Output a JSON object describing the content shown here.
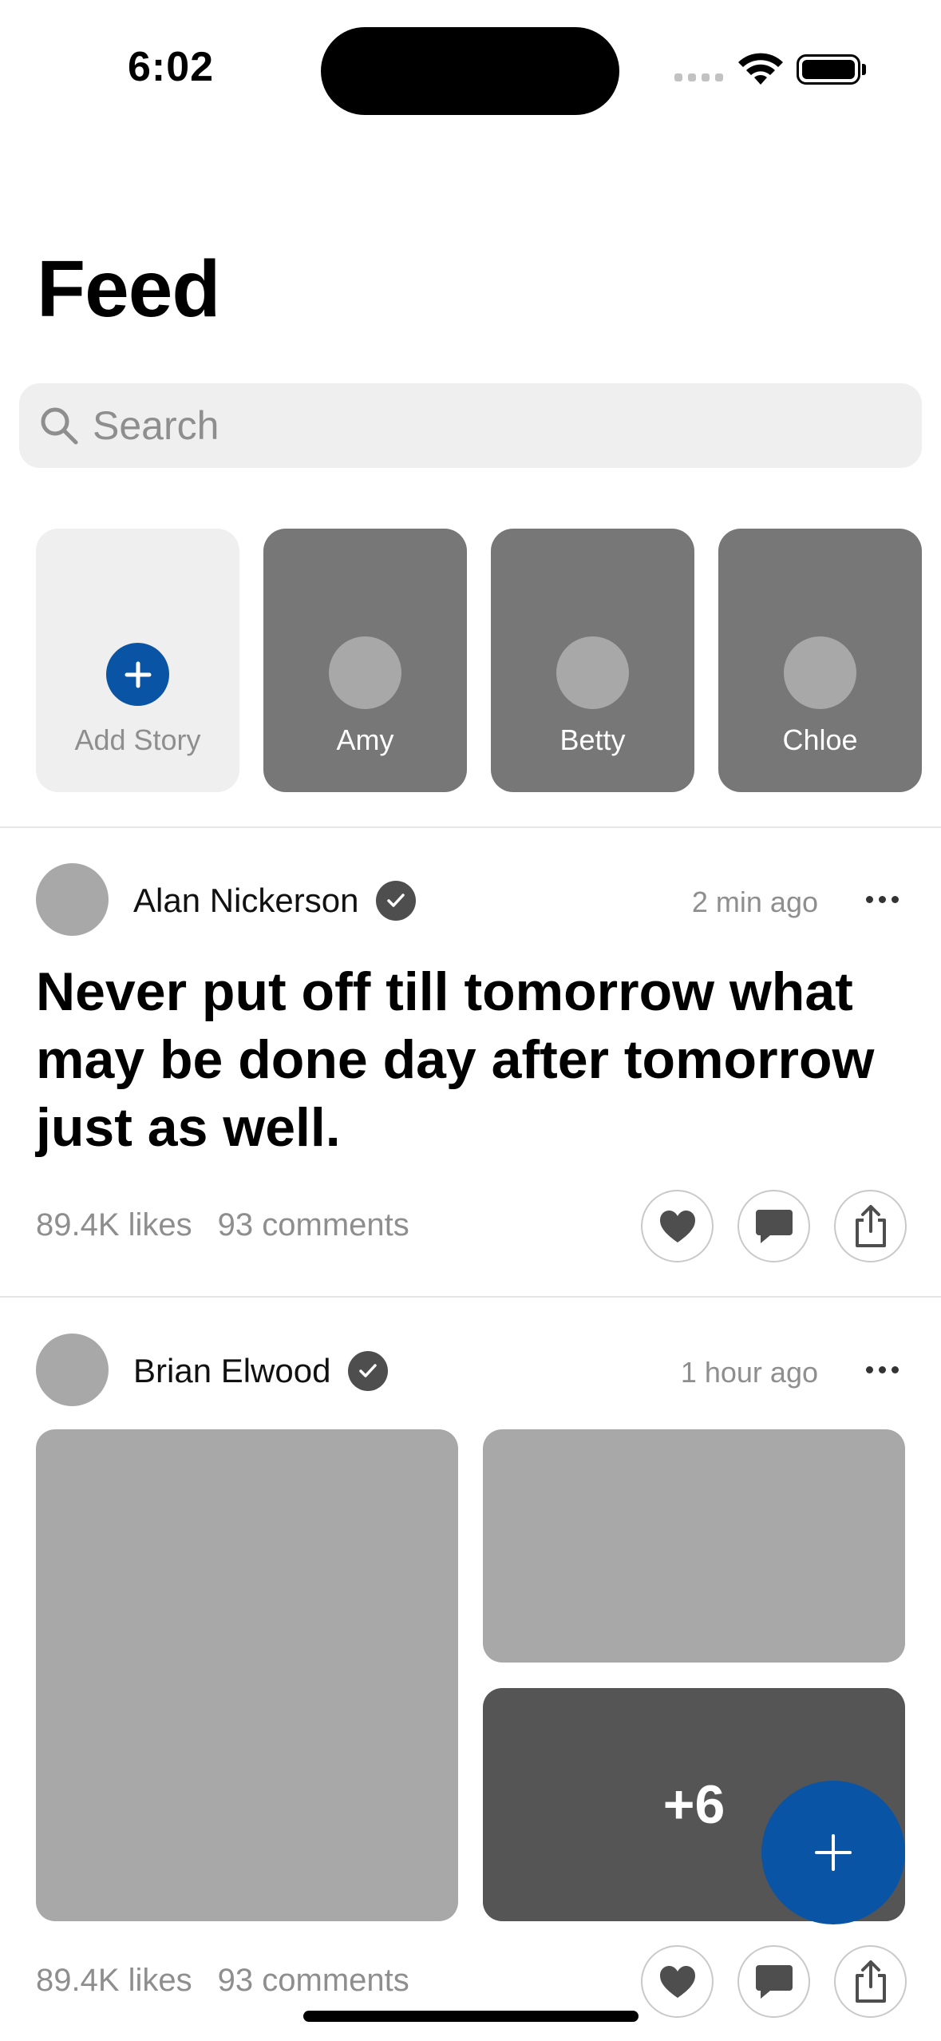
{
  "status_bar": {
    "time": "6:02"
  },
  "page": {
    "title": "Feed"
  },
  "search": {
    "placeholder": "Search"
  },
  "stories": [
    {
      "name": "Add Story",
      "type": "add"
    },
    {
      "name": "Amy"
    },
    {
      "name": "Betty"
    },
    {
      "name": "Chloe"
    }
  ],
  "posts": [
    {
      "author": "Alan Nickerson",
      "verified": true,
      "time": "2 min ago",
      "text": "Never put off till tomorrow what may be done day after tomorrow just as well.",
      "likes": "89.4K likes",
      "comments": "93 comments"
    },
    {
      "author": "Brian Elwood",
      "verified": true,
      "time": "1 hour ago",
      "extra_images": "+6",
      "likes": "89.4K likes",
      "comments": "93 comments"
    }
  ],
  "colors": {
    "accent": "#0a54a6",
    "story_tile": "#777777",
    "placeholder": "#a8a8a8",
    "muted_text": "#8e8e8e"
  }
}
